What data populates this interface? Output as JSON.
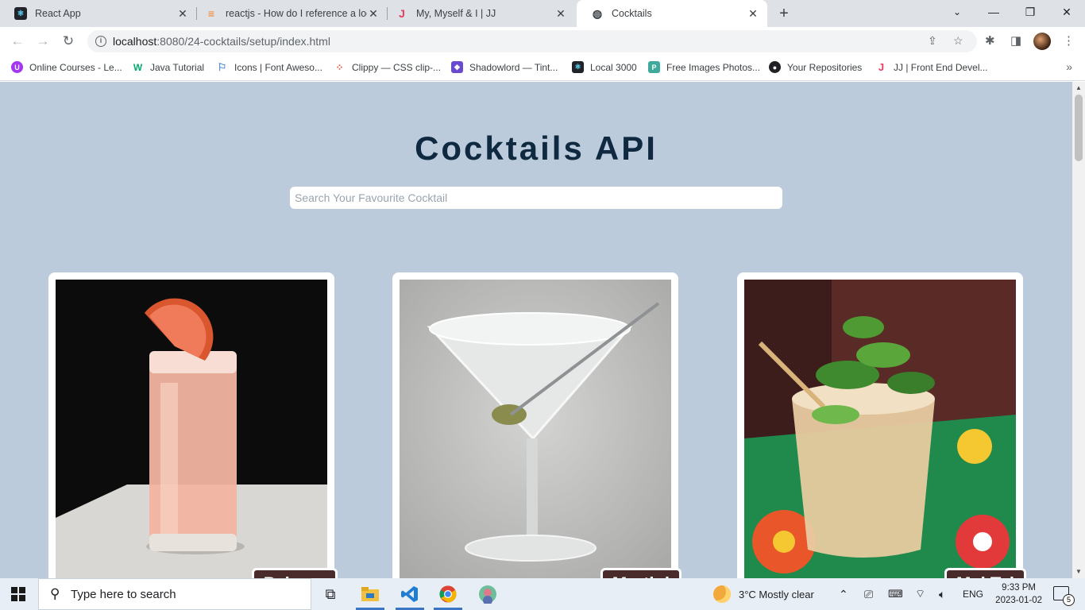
{
  "browser": {
    "tabs": [
      {
        "title": "React App",
        "active": false
      },
      {
        "title": "reactjs - How do I reference a loc",
        "active": false
      },
      {
        "title": "My, Myself & I | JJ",
        "active": false
      },
      {
        "title": "Cocktails",
        "active": true
      }
    ],
    "url_host": "localhost",
    "url_path": ":8080/24-cocktails/setup/index.html",
    "bookmarks": [
      "Online Courses - Le...",
      "Java Tutorial",
      "Icons | Font Aweso...",
      "Clippy — CSS clip-...",
      "Shadowlord — Tint...",
      "Local 3000",
      "Free Images Photos...",
      "Your Repositories",
      "JJ | Front End Devel..."
    ]
  },
  "page": {
    "title": "Cocktails API",
    "search_placeholder": "Search Your Favourite Cocktail",
    "cards": [
      {
        "name": "Paloma"
      },
      {
        "name": "Martini"
      },
      {
        "name": "Mai Tai"
      }
    ]
  },
  "taskbar": {
    "search_placeholder": "Type here to search",
    "weather": "3°C  Mostly clear",
    "language": "ENG",
    "time": "9:33 PM",
    "date": "2023-01-02",
    "notifications": "5"
  }
}
